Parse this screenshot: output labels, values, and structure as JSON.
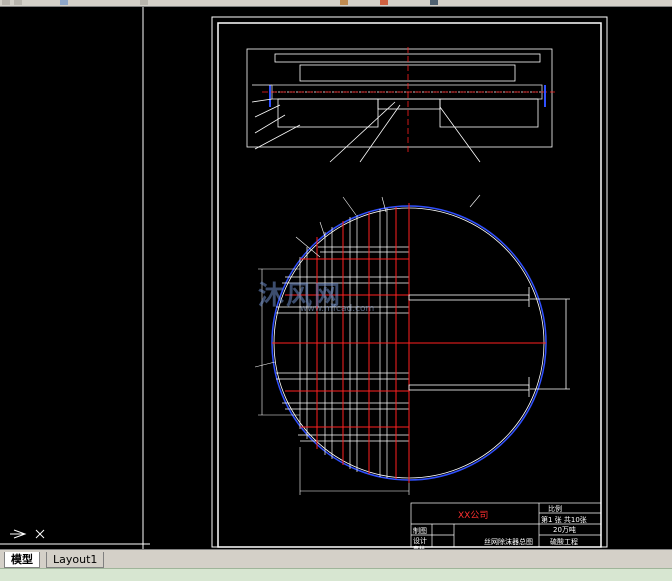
{
  "tabs": {
    "model": "模型",
    "layout1": "Layout1"
  },
  "title_block": {
    "company": "XX公司",
    "rows_left": [
      "制图",
      "设计",
      "审核"
    ],
    "drawing_name": "丝网除沫器总图",
    "scale_label": "比例",
    "sheet_info": "第1 张 共10张",
    "project": "20万吨",
    "department": "硫酸工程"
  },
  "watermark": {
    "main": "沐风网",
    "sub": "www.mfcad.com"
  },
  "colors": {
    "canvas_bg": "#000000",
    "line_white": "#ffffff",
    "line_red": "#ff2020",
    "line_blue": "#3050ff"
  },
  "icons": [
    "toolbar-icons",
    "ucs-icon"
  ]
}
